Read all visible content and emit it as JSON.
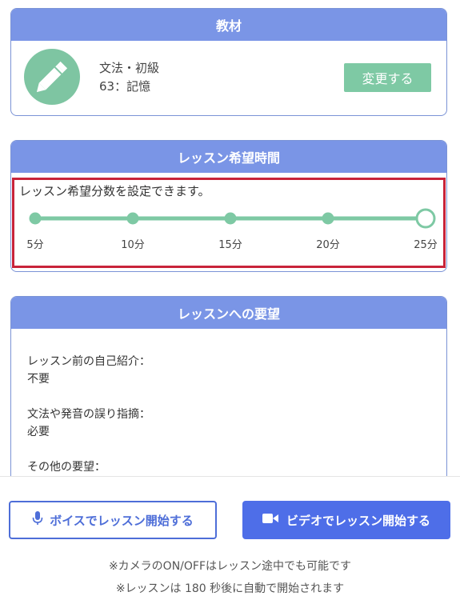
{
  "material": {
    "header": "教材",
    "line1": "文法・初級",
    "line2": "63：記憶",
    "change_label": "変更する",
    "icon": "pencil-icon"
  },
  "lesson_time": {
    "header": "レッスン希望時間",
    "description": "レッスン希望分数を設定できます。",
    "options": [
      "5分",
      "10分",
      "15分",
      "20分",
      "25分"
    ],
    "selected_index": 4
  },
  "requests": {
    "header": "レッスンへの要望",
    "items": [
      {
        "label": "レッスン前の自己紹介：",
        "value": "不要"
      },
      {
        "label": "文法や発音の誤り指摘：",
        "value": "必要"
      },
      {
        "label": "その他の要望：",
        "value": ""
      }
    ]
  },
  "actions": {
    "voice_label": "ボイスでレッスン開始する",
    "video_label": "ビデオでレッスン開始する",
    "voice_icon": "microphone-icon",
    "video_icon": "video-camera-icon"
  },
  "notes": {
    "camera": "※カメラのON/OFFはレッスン途中でも可能です",
    "auto_start": "※レッスンは 180 秒後に自動で開始されます"
  },
  "colors": {
    "header": "#7a95e6",
    "accent_green": "#7ec9a4",
    "primary_blue": "#4e6ee8",
    "highlight_red": "#c8243a"
  }
}
